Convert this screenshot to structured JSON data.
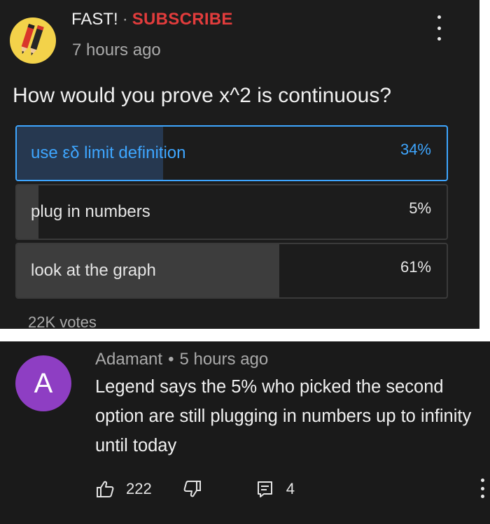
{
  "post": {
    "channel_name": "FAST!",
    "separator": "·",
    "subscribe_label": "SUBSCRIBE",
    "time_ago": "7 hours ago",
    "question": "How would you prove x^2 is continuous?",
    "poll_options": [
      {
        "label": "use εδ limit definition",
        "percent_text": "34%",
        "percent": 34,
        "selected": true
      },
      {
        "label": "plug in numbers",
        "percent_text": "5%",
        "percent": 5,
        "selected": false
      },
      {
        "label": "look at the graph",
        "percent_text": "61%",
        "percent": 61,
        "selected": false
      }
    ],
    "votes": "22K votes",
    "avatar_icon": "crossed-pencils-icon",
    "menu_icon": "more-vertical-icon"
  },
  "comment": {
    "avatar_letter": "A",
    "author": "Adamant",
    "separator": "•",
    "time_ago": "5 hours ago",
    "text": "Legend says the 5% who picked the second option are still plugging in numbers up to infinity until today",
    "like_count": "222",
    "reply_count": "4",
    "icons": {
      "like": "thumbs-up-icon",
      "dislike": "thumbs-down-icon",
      "reply": "reply-comment-icon",
      "menu": "more-vertical-icon"
    }
  },
  "colors": {
    "panel_bg": "#1c1c1c",
    "accent_blue": "#3ea6ff",
    "subscribe_red": "#e23c3c",
    "avatar_purple": "#8e3ec3",
    "avatar_yellow": "#f3d24a"
  }
}
